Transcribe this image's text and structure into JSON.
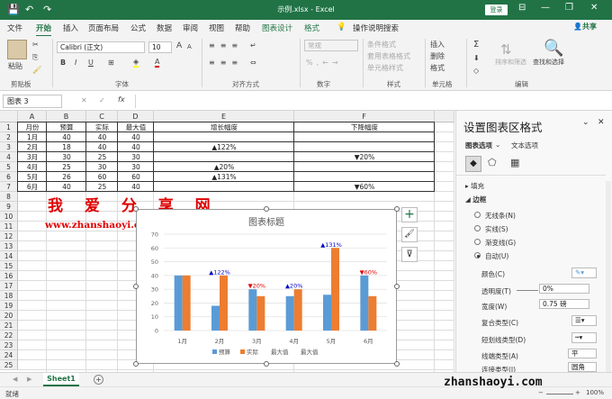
{
  "titlebar": {
    "file_title": "示例.xlsx  -  Excel",
    "login": "登录",
    "qa_save": "💾",
    "qa_undo": "↶",
    "qa_redo": "↷",
    "minimize": "—",
    "restore": "❐",
    "close": "✕",
    "ribbon_opts": "⊟"
  },
  "tabs": [
    "文件",
    "开始",
    "插入",
    "页面布局",
    "公式",
    "数据",
    "审阅",
    "视图",
    "帮助",
    "图表设计",
    "格式"
  ],
  "tell_me": "操作说明搜索",
  "share": "共享",
  "ribbon": {
    "paste": "粘贴",
    "clipboard": "剪贴板",
    "font_name": "Calibri (正文)",
    "font_size": "10",
    "grow_font": "A",
    "shrink_font": "A",
    "bold": "B",
    "italic": "I",
    "underline": "U",
    "font_group": "字体",
    "align_group": "对齐方式",
    "number_format": "常规",
    "number_group": "数字",
    "cond_format": "条件格式",
    "table_format": "套用表格格式",
    "cell_style": "单元格样式",
    "styles_group": "样式",
    "insert": "插入",
    "delete": "删除",
    "format": "格式",
    "cells_group": "单元格",
    "sort_filter": "排序和筛选",
    "find_select": "查找和选择",
    "edit_group": "编辑"
  },
  "formula_bar": {
    "name_box": "图表 3",
    "cancel": "✕",
    "enter": "✓",
    "fx": "fx",
    "value": ""
  },
  "grid": {
    "columns": [
      "A",
      "B",
      "C",
      "D",
      "E",
      "F"
    ],
    "row_numbers": [
      "1",
      "2",
      "3",
      "4",
      "5",
      "6",
      "7",
      "8",
      "9",
      "10",
      "11",
      "12",
      "13",
      "14",
      "15",
      "16",
      "17",
      "18",
      "19",
      "20",
      "21",
      "22",
      "23",
      "24",
      "25"
    ],
    "table_rows": [
      [
        "月份",
        "预算",
        "实际",
        "最大值",
        "增长幅度",
        "下降幅度"
      ],
      [
        "1月",
        "40",
        "40",
        "40",
        "",
        ""
      ],
      [
        "2月",
        "18",
        "40",
        "40",
        "▲122%",
        ""
      ],
      [
        "3月",
        "30",
        "25",
        "30",
        "",
        "▼20%"
      ],
      [
        "4月",
        "25",
        "30",
        "30",
        "▲20%",
        ""
      ],
      [
        "5月",
        "26",
        "60",
        "60",
        "▲131%",
        ""
      ],
      [
        "6月",
        "40",
        "25",
        "40",
        "",
        "▼60%"
      ]
    ]
  },
  "watermark": {
    "title": "我 爱 分 享 网",
    "url": "www.zhanshaoyi.com"
  },
  "chart_data": {
    "type": "bar",
    "title": "图表标题",
    "categories": [
      "1月",
      "2月",
      "3月",
      "4月",
      "5月",
      "6月"
    ],
    "series": [
      {
        "name": "预算",
        "values": [
          40,
          18,
          30,
          25,
          26,
          40
        ],
        "color": "#5b9bd5"
      },
      {
        "name": "实际",
        "values": [
          40,
          40,
          25,
          30,
          60,
          25
        ],
        "color": "#ed7d31"
      }
    ],
    "legend_extra": [
      "最大值",
      "最大值"
    ],
    "ylim": [
      0,
      70
    ],
    "yticks": [
      "0",
      "10",
      "20",
      "30",
      "40",
      "50",
      "60",
      "70"
    ],
    "annotations": [
      {
        "category": "2月",
        "text": "▲122%",
        "value": 40,
        "color": "#0000cc"
      },
      {
        "category": "3月",
        "text": "▼20%",
        "value": 30,
        "color": "#dd0000"
      },
      {
        "category": "4月",
        "text": "▲20%",
        "value": 30,
        "color": "#0000cc"
      },
      {
        "category": "5月",
        "text": "▲131%",
        "value": 60,
        "color": "#0000cc"
      },
      {
        "category": "6月",
        "text": "▼60%",
        "value": 40,
        "color": "#dd0000"
      }
    ],
    "grid": true,
    "legend_position": "bottom"
  },
  "chart_buttons": {
    "add": "+",
    "style": "🖌",
    "filter": "⊽"
  },
  "pane": {
    "title": "设置图表区格式",
    "close": "✕",
    "dropdown": "⌄",
    "tab_chart_options": "图表选项",
    "tab_text_options": "文本选项",
    "section_fill": "填充",
    "section_border": "边框",
    "radios": [
      "无线条(N)",
      "实线(S)",
      "渐变线(G)",
      "自动(U)"
    ],
    "color_label": "颜色(C)",
    "transparency_label": "透明度(T)",
    "transparency_value": "0%",
    "width_label": "宽度(W)",
    "width_value": "0.75 磅",
    "compound_label": "复合类型(C)",
    "dash_label": "短划线类型(D)",
    "cap_label": "线端类型(A)",
    "cap_value": "平",
    "join_label": "连接类型(J)",
    "join_value": "圆角"
  },
  "sheetbar": {
    "sheet_name": "Sheet1",
    "add_sheet": "+",
    "prev": "◀",
    "next": "▶"
  },
  "status": {
    "ready": "就绪",
    "zoom": "100%",
    "minus": "−",
    "plus": "+",
    "site": "zhanshaoyi.com"
  },
  "colors": {
    "excel_green": "#217346",
    "budget": "#5b9bd5",
    "actual": "#ed7d31",
    "up": "#0000cc",
    "down": "#dd0000"
  }
}
